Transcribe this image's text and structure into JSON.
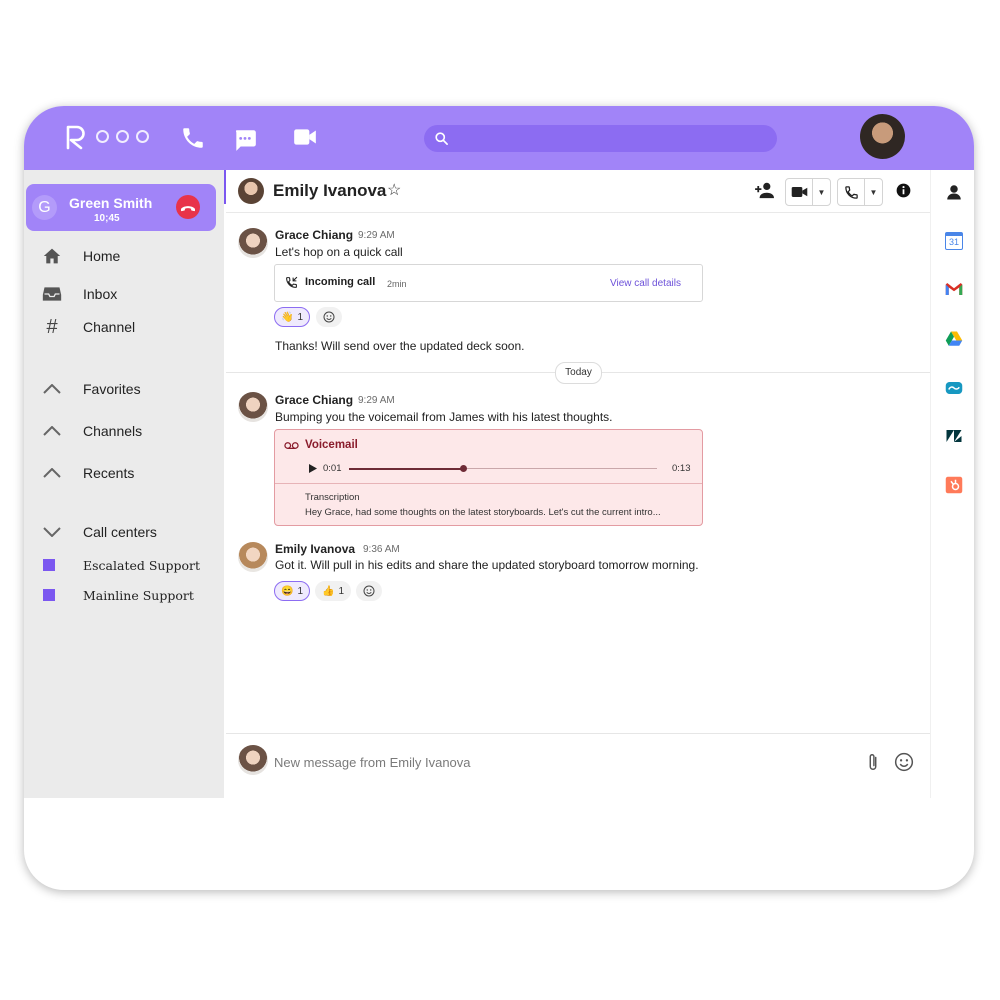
{
  "app": {
    "logo_letter": "R",
    "search": {
      "placeholder": ""
    },
    "colors": {
      "brand": "#a184f8",
      "search_bg": "#8c6cf2",
      "accent": "#7b57f0",
      "hangup": "#e8334a",
      "voicemail_bg": "#fde8e9"
    }
  },
  "active_call": {
    "initial": "G",
    "name": "Green Smith",
    "duration": "10;45"
  },
  "sidebar": {
    "nav": [
      {
        "label": "Home",
        "icon": "home-icon"
      },
      {
        "label": "Inbox",
        "icon": "inbox-icon"
      },
      {
        "label": "Channel",
        "icon": "hash-icon"
      }
    ],
    "sections": [
      {
        "label": "Favorites",
        "icon": "chevron-up-icon"
      },
      {
        "label": "Channels",
        "icon": "chevron-up-icon"
      },
      {
        "label": "Recents",
        "icon": "chevron-up-icon"
      },
      {
        "label": "Call centers",
        "icon": "chevron-down-icon"
      }
    ],
    "call_centers": [
      {
        "label": "Escalated Support"
      },
      {
        "label": "Mainline Support"
      }
    ]
  },
  "conversation": {
    "contact_name": "Emily Ivanova",
    "star": "☆",
    "messages": [
      {
        "sender": "Grace Chiang",
        "time": "9:29 AM",
        "text": "Let's hop on a quick call",
        "call_card": {
          "label": "Incoming call",
          "duration": "2min",
          "link": "View call details"
        },
        "reactions": [
          {
            "emoji": "👋",
            "count": "1"
          }
        ],
        "followup": "Thanks! Will send over the updated deck soon."
      },
      {
        "sender": "Grace Chiang",
        "time": "9:29 AM",
        "text": "Bumping you the voicemail from James with his latest thoughts.",
        "voicemail": {
          "title": "Voicemail",
          "current": "0:01",
          "total": "0:13",
          "progress": 0.37,
          "transcription_label": "Transcription",
          "transcription": "Hey Grace, had some thoughts on the latest storyboards. Let's cut the current intro..."
        }
      },
      {
        "sender": "Emily Ivanova",
        "time": "9:36 AM",
        "text": "Got it. Will pull in his edits and share the updated storyboard tomorrow morning.",
        "reactions": [
          {
            "emoji": "😄",
            "count": "1"
          },
          {
            "emoji": "👍",
            "count": "1"
          }
        ]
      }
    ],
    "divider": "Today",
    "composer": {
      "placeholder": "New message from Emily Ivanova"
    }
  },
  "right_rail": {
    "apps": [
      "contact-icon",
      "google-calendar-icon",
      "gmail-icon",
      "google-drive-icon",
      "salesforce-icon",
      "zendesk-icon",
      "hubspot-icon"
    ],
    "calendar_day": "31"
  }
}
